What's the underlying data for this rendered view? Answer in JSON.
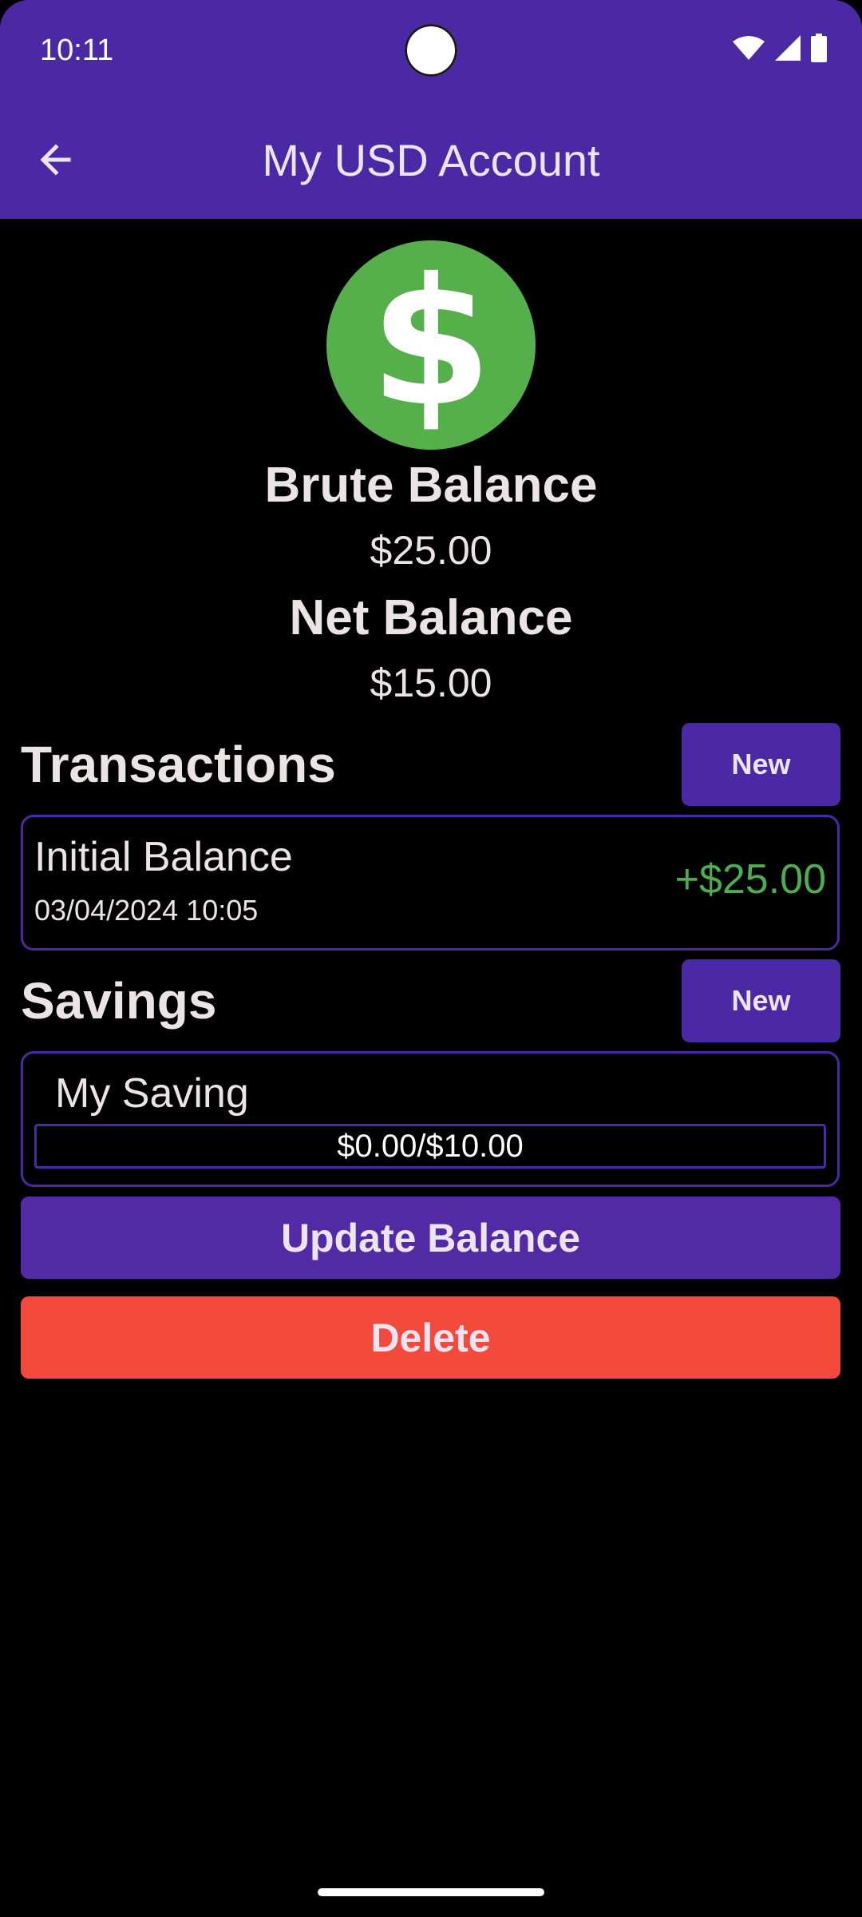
{
  "status_bar": {
    "time": "10:11",
    "icons": [
      "wifi-icon",
      "signal-icon",
      "battery-icon"
    ]
  },
  "app_bar": {
    "back_icon": "arrow-left-icon",
    "title": "My USD Account"
  },
  "account": {
    "icon": "dollar-icon",
    "icon_glyph": "$",
    "brute_label": "Brute Balance",
    "brute_value": "$25.00",
    "net_label": "Net Balance",
    "net_value": "$15.00"
  },
  "transactions": {
    "header": "Transactions",
    "new_label": "New",
    "items": [
      {
        "title": "Initial Balance",
        "date": "03/04/2024 10:05",
        "amount": "+$25.00"
      }
    ]
  },
  "savings": {
    "header": "Savings",
    "new_label": "New",
    "items": [
      {
        "name": "My Saving",
        "progress_label": "$0.00/$10.00",
        "progress_fraction": 0
      }
    ]
  },
  "actions": {
    "update_label": "Update Balance",
    "delete_label": "Delete"
  },
  "colors": {
    "primary": "#4b28a4",
    "positive": "#4cae4f",
    "danger": "#f44a3e",
    "dollar_circle": "#55b04c"
  }
}
